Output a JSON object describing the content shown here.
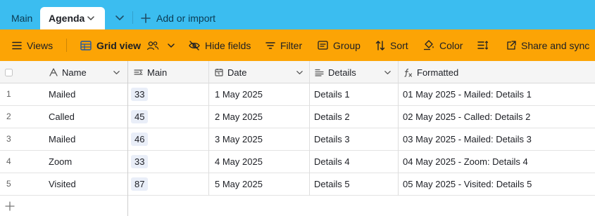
{
  "tabs": {
    "main_label": "Main",
    "active_label": "Agenda",
    "add_import_label": "Add or import"
  },
  "toolbar": {
    "views_label": "Views",
    "view_name": "Grid view",
    "hide_fields_label": "Hide fields",
    "filter_label": "Filter",
    "group_label": "Group",
    "sort_label": "Sort",
    "color_label": "Color",
    "share_label": "Share and sync"
  },
  "columns": {
    "name": "Name",
    "main": "Main",
    "date": "Date",
    "details": "Details",
    "formatted": "Formatted"
  },
  "rows": [
    {
      "num": "1",
      "name": "Mailed",
      "main": "33",
      "date": "1 May 2025",
      "details": "Details 1",
      "formatted": "01 May 2025 - Mailed: Details 1"
    },
    {
      "num": "2",
      "name": "Called",
      "main": "45",
      "date": "2 May 2025",
      "details": "Details 2",
      "formatted": "02 May 2025 - Called: Details 2"
    },
    {
      "num": "3",
      "name": "Mailed",
      "main": "46",
      "date": "3 May 2025",
      "details": "Details 3",
      "formatted": "03 May 2025 - Mailed: Details 3"
    },
    {
      "num": "4",
      "name": "Zoom",
      "main": "33",
      "date": "4 May 2025",
      "details": "Details 4",
      "formatted": "04 May 2025 - Zoom: Details 4"
    },
    {
      "num": "5",
      "name": "Visited",
      "main": "87",
      "date": "5 May 2025",
      "details": "Details 5",
      "formatted": "05 May 2025 - Visited: Details 5"
    }
  ],
  "colors": {
    "tabbar": "#3bbdf0",
    "toolbar": "#fca405",
    "number_chip": "#e9eef8"
  },
  "icons": [
    "chevron-down-icon",
    "plus-icon",
    "hamburger-icon",
    "grid-icon",
    "people-icon",
    "eye-slash-icon",
    "filter-icon",
    "group-icon",
    "sort-icon",
    "paint-bucket-icon",
    "row-height-icon",
    "share-icon",
    "text-field-icon",
    "number-field-icon",
    "calendar-icon",
    "long-text-icon",
    "formula-icon"
  ]
}
